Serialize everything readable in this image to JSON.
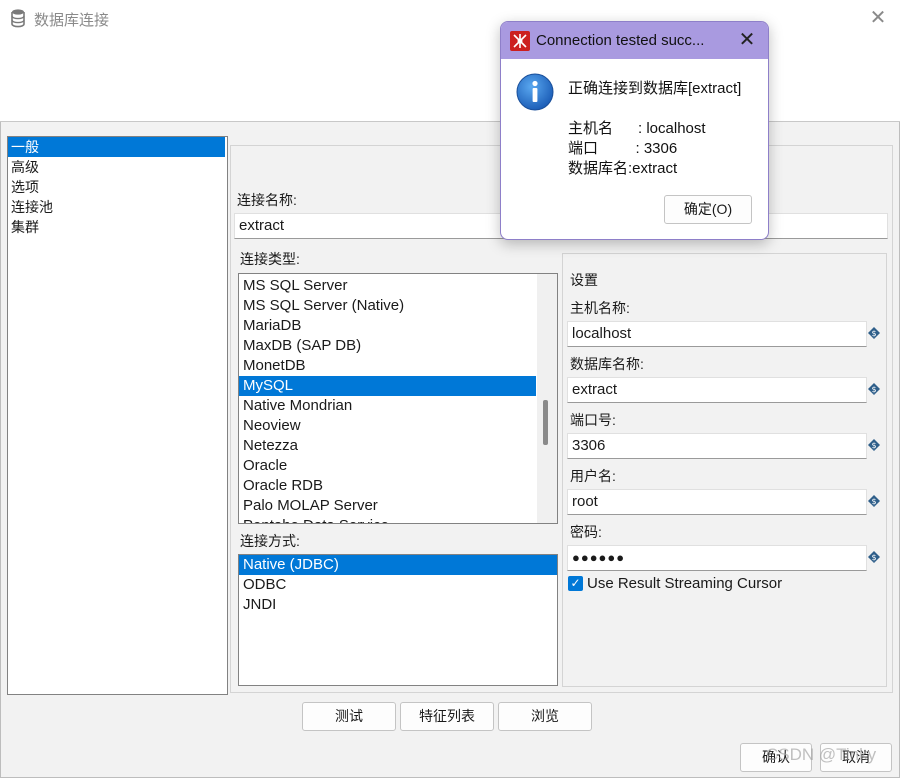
{
  "window": {
    "title": "数据库连接",
    "close_glyph": "✕",
    "title_icon": "database-icon"
  },
  "left_nav": {
    "items": [
      {
        "label": "一般",
        "selected": true
      },
      {
        "label": "高级",
        "selected": false
      },
      {
        "label": "选项",
        "selected": false
      },
      {
        "label": "连接池",
        "selected": false
      },
      {
        "label": "集群",
        "selected": false
      }
    ]
  },
  "connection_name": {
    "label": "连接名称:",
    "value": "extract"
  },
  "connection_type": {
    "label": "连接类型:",
    "items": [
      {
        "label": "MS SQL Server",
        "selected": false
      },
      {
        "label": "MS SQL Server (Native)",
        "selected": false
      },
      {
        "label": "MariaDB",
        "selected": false
      },
      {
        "label": "MaxDB (SAP DB)",
        "selected": false
      },
      {
        "label": "MonetDB",
        "selected": false
      },
      {
        "label": "MySQL",
        "selected": true
      },
      {
        "label": "Native Mondrian",
        "selected": false
      },
      {
        "label": "Neoview",
        "selected": false
      },
      {
        "label": "Netezza",
        "selected": false
      },
      {
        "label": "Oracle",
        "selected": false
      },
      {
        "label": "Oracle RDB",
        "selected": false
      },
      {
        "label": "Palo MOLAP Server",
        "selected": false
      },
      {
        "label": "Pentaho Data Service",
        "selected": false
      }
    ]
  },
  "access_method": {
    "label": "连接方式:",
    "items": [
      {
        "label": "Native (JDBC)",
        "selected": true
      },
      {
        "label": "ODBC",
        "selected": false
      },
      {
        "label": "JNDI",
        "selected": false
      }
    ]
  },
  "settings": {
    "title": "设置",
    "host_label": "主机名称:",
    "host_value": "localhost",
    "dbname_label": "数据库名称:",
    "dbname_value": "extract",
    "port_label": "端口号:",
    "port_value": "3306",
    "user_label": "用户名:",
    "user_value": "root",
    "password_label": "密码:",
    "password_value": "●●●●●●",
    "streaming_label": "Use Result Streaming Cursor",
    "streaming_checked": true
  },
  "buttons": {
    "test": "测试",
    "features": "特征列表",
    "explore": "浏览",
    "ok": "确认",
    "cancel": "取消"
  },
  "watermark": "CSDN @Tinky",
  "dialog": {
    "title": "Connection tested succ...",
    "close_glyph": "✕",
    "message": "正确连接到数据库[extract]",
    "host_line": "主机名      : localhost",
    "port_line": "端口         : 3306",
    "db_line": "数据库名:extract",
    "ok_label": "确定(O)",
    "icon": "info-icon"
  },
  "colors": {
    "selection": "#0078d7",
    "dialog_titlebar": "#a99ae0",
    "dialog_border": "#8e7fc9"
  }
}
